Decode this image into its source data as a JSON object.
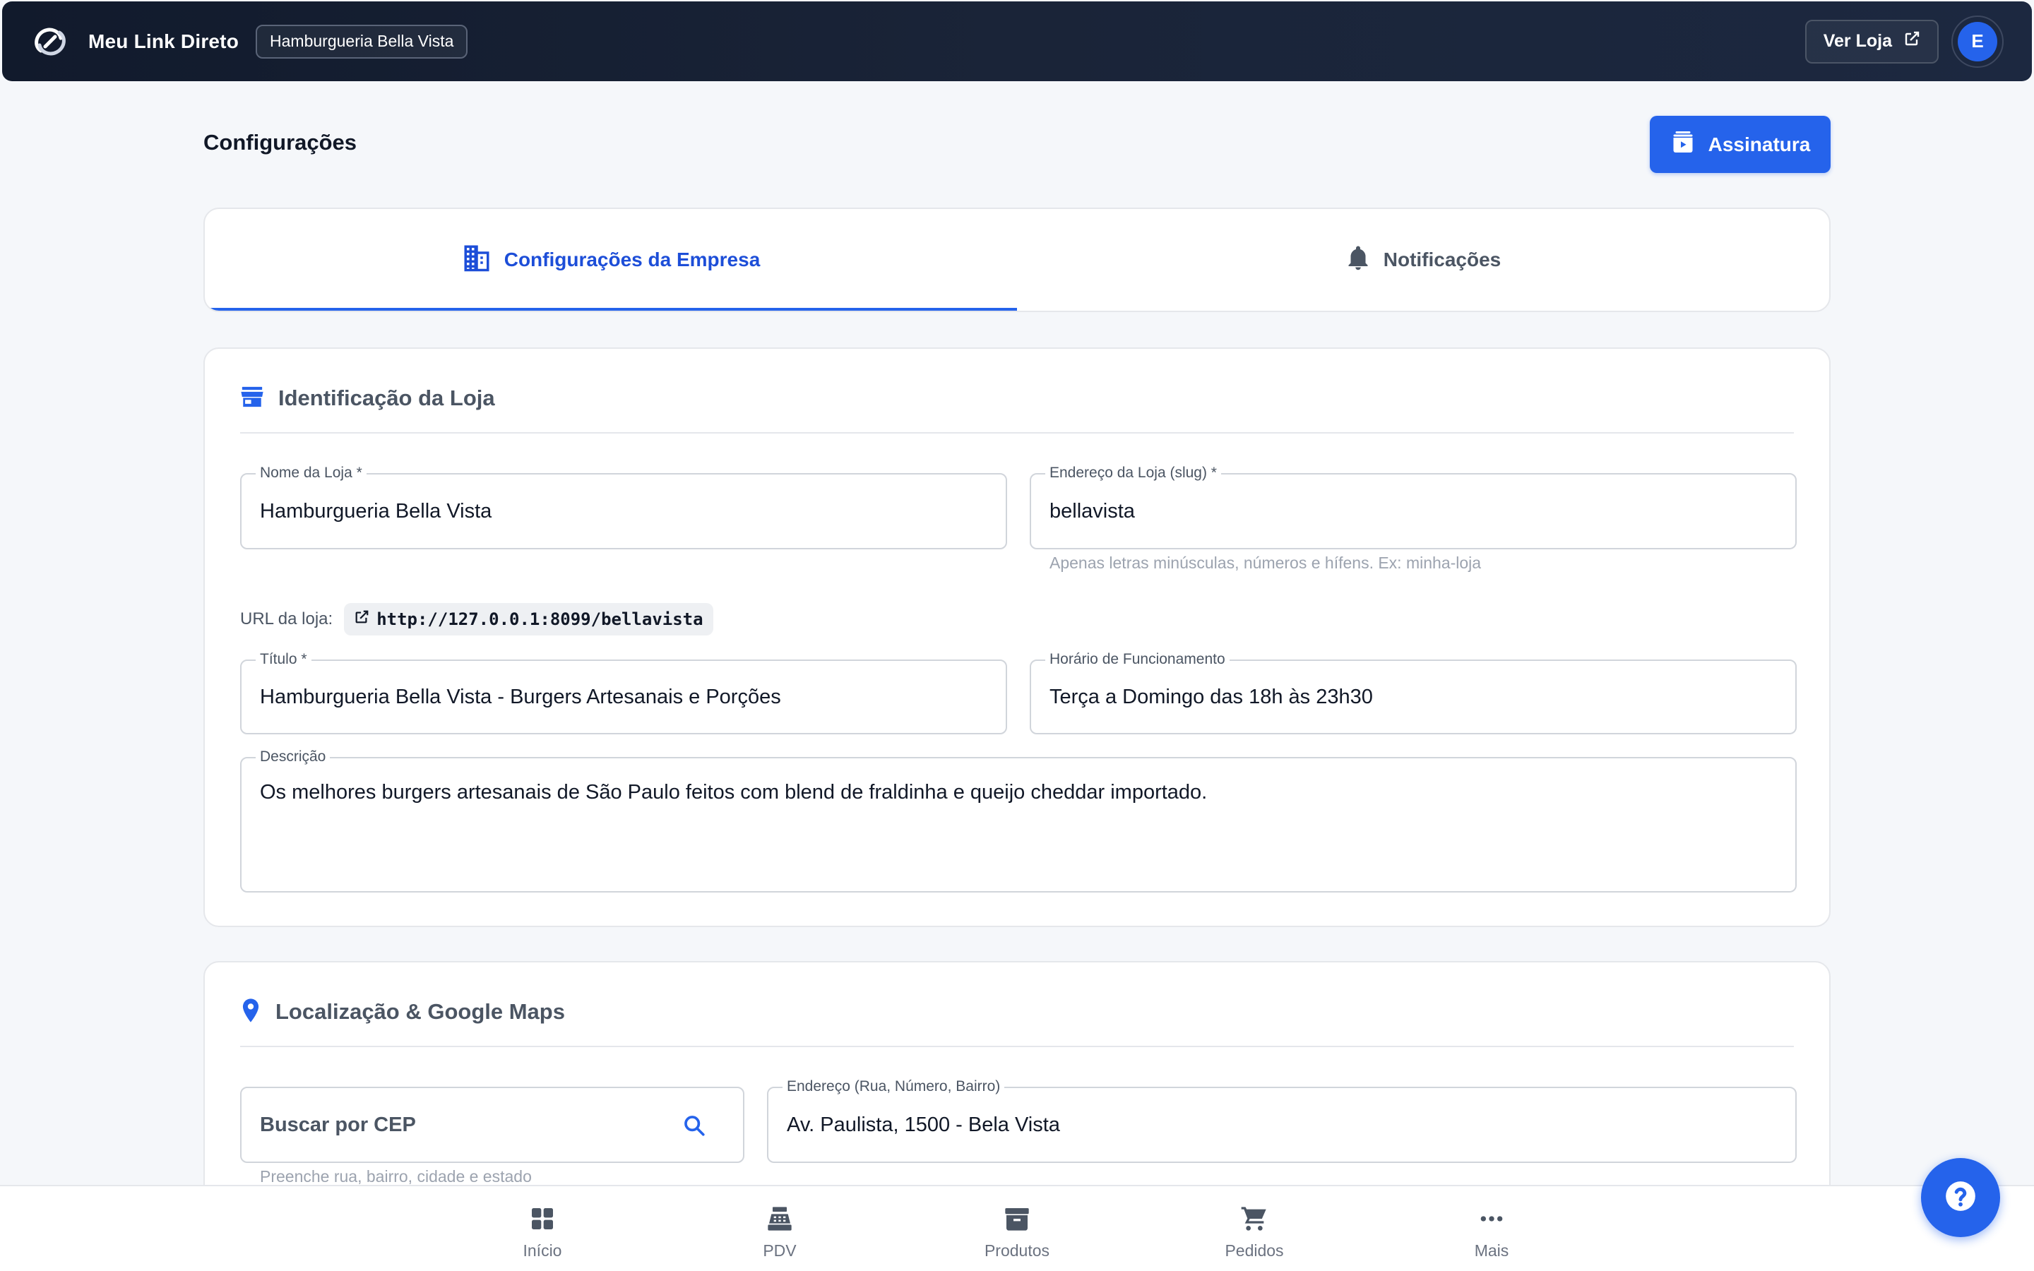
{
  "header": {
    "brand": "Meu Link Direto",
    "store_chip": "Hamburgueria Bella Vista",
    "ver_loja_label": "Ver Loja",
    "avatar_initial": "E"
  },
  "page": {
    "title": "Configurações",
    "assinatura_label": "Assinatura"
  },
  "tabs": [
    {
      "label": "Configurações da Empresa",
      "icon": "building-icon",
      "active": true
    },
    {
      "label": "Notificações",
      "icon": "bell-icon",
      "active": false
    }
  ],
  "identificacao": {
    "title": "Identificação da Loja",
    "nome_label": "Nome da Loja *",
    "nome_value": "Hamburgueria Bella Vista",
    "slug_label": "Endereço da Loja (slug) *",
    "slug_value": "bellavista",
    "slug_helper": "Apenas letras minúsculas, números e hífens. Ex: minha-loja",
    "url_label": "URL da loja:",
    "url_value": "http://127.0.0.1:8099/bellavista",
    "titulo_label": "Título *",
    "titulo_value": "Hamburgueria Bella Vista - Burgers Artesanais e Porções",
    "horario_label": "Horário de Funcionamento",
    "horario_value": "Terça a Domingo das 18h às 23h30",
    "descricao_label": "Descrição",
    "descricao_value": "Os melhores burgers artesanais de São Paulo feitos com blend de fraldinha e queijo cheddar importado."
  },
  "localizacao": {
    "title": "Localização & Google Maps",
    "cep_placeholder": "Buscar por CEP",
    "cep_helper": "Preenche rua, bairro, cidade e estado",
    "endereco_label": "Endereço (Rua, Número, Bairro)",
    "endereco_value": "Av. Paulista, 1500 - Bela Vista"
  },
  "bottom_nav": [
    {
      "label": "Início",
      "icon": "grid-icon"
    },
    {
      "label": "PDV",
      "icon": "cash-register-icon"
    },
    {
      "label": "Produtos",
      "icon": "archive-box-icon"
    },
    {
      "label": "Pedidos",
      "icon": "cart-icon"
    },
    {
      "label": "Mais",
      "icon": "more-dots-icon"
    }
  ],
  "colors": {
    "primary": "#2563eb",
    "appbar": "#111a2c",
    "background": "#f5f7fa"
  }
}
